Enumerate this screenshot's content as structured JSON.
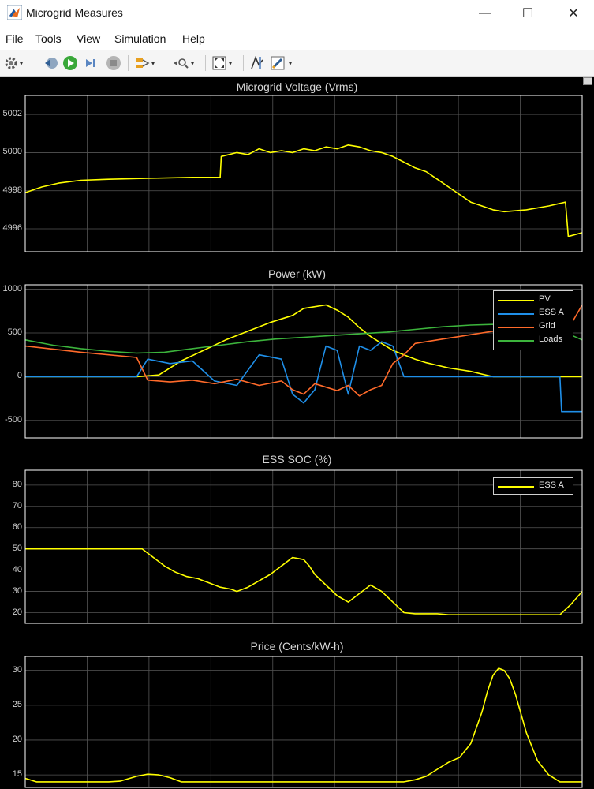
{
  "window": {
    "title": "Microgrid Measures",
    "minimize": "—",
    "maximize": "☐",
    "close": "✕"
  },
  "menu": [
    "File",
    "Tools",
    "View",
    "Simulation",
    "Help"
  ],
  "toolbar": {
    "icons": [
      "settings-icon",
      "step-back-icon",
      "run-icon",
      "step-forward-icon",
      "stop-icon",
      "highlight-icon",
      "zoom-icon",
      "autoscale-icon",
      "cursor-measure-icon",
      "style-icon"
    ]
  },
  "colors": {
    "pv": "#ffff00",
    "ess": "#1f8fe8",
    "grid": "#ff6a2a",
    "loads": "#3cb43c",
    "axis": "#ffffff",
    "grid_lines": "#555555"
  },
  "plots": [
    {
      "title": "Microgrid Voltage (Vrms)",
      "yticks": [
        "5002",
        "5000",
        "4998",
        "4996"
      ]
    },
    {
      "title": "Power  (kW)",
      "yticks": [
        "1000",
        "500",
        "0",
        "-500"
      ],
      "legend": [
        "PV",
        "ESS A",
        "Grid",
        "Loads"
      ]
    },
    {
      "title": "ESS SOC (%)",
      "yticks": [
        "80",
        "70",
        "60",
        "50",
        "40",
        "30",
        "20"
      ],
      "legend": [
        "ESS A"
      ]
    },
    {
      "title": "Price (Cents/kW-h)",
      "yticks": [
        "30",
        "25",
        "20",
        "15"
      ]
    }
  ],
  "chart_data": [
    {
      "type": "line",
      "title": "Microgrid Voltage (Vrms)",
      "ylim": [
        4994.8,
        5003
      ],
      "xlim": [
        0,
        100
      ],
      "grid": true,
      "series": [
        {
          "x": [
            0,
            3,
            6,
            10,
            15,
            22,
            30,
            35,
            35.2,
            38,
            40,
            42,
            44,
            46,
            48,
            50,
            52,
            54,
            56,
            58,
            60,
            62,
            64,
            66,
            68,
            70,
            72,
            74,
            76,
            78,
            80,
            82,
            84,
            86,
            90,
            94,
            97,
            97.5,
            100
          ],
          "y": [
            4997.9,
            4998.2,
            4998.4,
            4998.55,
            4998.6,
            4998.65,
            4998.7,
            4998.7,
            4999.8,
            5000.0,
            4999.9,
            5000.2,
            5000.0,
            5000.1,
            5000.0,
            5000.2,
            5000.1,
            5000.3,
            5000.2,
            5000.4,
            5000.3,
            5000.1,
            5000.0,
            4999.8,
            4999.5,
            4999.2,
            4999.0,
            4998.6,
            4998.2,
            4997.8,
            4997.4,
            4997.2,
            4997.0,
            4996.9,
            4997.0,
            4997.2,
            4997.4,
            4995.6,
            4995.8
          ]
        }
      ]
    },
    {
      "type": "line",
      "title": "Power  (kW)",
      "ylim": [
        -700,
        1050
      ],
      "xlim": [
        0,
        100
      ],
      "grid": true,
      "legend_position": "top-right",
      "series": [
        {
          "name": "PV",
          "x": [
            0,
            20,
            24,
            28,
            32,
            36,
            40,
            44,
            48,
            50,
            52,
            54,
            56,
            58,
            60,
            62,
            64,
            66,
            68,
            70,
            72,
            74,
            76,
            78,
            80,
            82,
            84,
            88,
            100
          ],
          "y": [
            0,
            0,
            20,
            180,
            300,
            420,
            520,
            620,
            700,
            780,
            800,
            820,
            760,
            680,
            560,
            460,
            380,
            300,
            250,
            200,
            160,
            130,
            100,
            80,
            60,
            30,
            0,
            0,
            0
          ]
        },
        {
          "name": "ESS A",
          "x": [
            0,
            20,
            22,
            26,
            30,
            34,
            38,
            42,
            46,
            48,
            50,
            52,
            54,
            56,
            58,
            60,
            62,
            64,
            66,
            68,
            70,
            74,
            78,
            82,
            90,
            96,
            96.3,
            100
          ],
          "y": [
            0,
            0,
            200,
            150,
            180,
            -50,
            -100,
            250,
            200,
            -200,
            -300,
            -150,
            350,
            300,
            -200,
            350,
            300,
            400,
            350,
            0,
            0,
            0,
            0,
            0,
            0,
            0,
            -400,
            -400
          ]
        },
        {
          "name": "Grid",
          "x": [
            0,
            10,
            20,
            22,
            26,
            30,
            34,
            38,
            42,
            46,
            48,
            50,
            52,
            54,
            56,
            58,
            60,
            62,
            64,
            66,
            68,
            70,
            72,
            74,
            76,
            78,
            80,
            82,
            84,
            86,
            90,
            94,
            98,
            100
          ],
          "y": [
            350,
            280,
            220,
            -40,
            -60,
            -40,
            -80,
            -30,
            -100,
            -50,
            -150,
            -200,
            -80,
            -120,
            -160,
            -100,
            -220,
            -150,
            -100,
            150,
            250,
            380,
            400,
            420,
            440,
            460,
            480,
            500,
            520,
            540,
            560,
            580,
            600,
            820
          ]
        },
        {
          "name": "Loads",
          "x": [
            0,
            5,
            10,
            15,
            20,
            25,
            30,
            35,
            40,
            45,
            50,
            55,
            60,
            65,
            70,
            75,
            80,
            85,
            90,
            95,
            100
          ],
          "y": [
            420,
            360,
            320,
            290,
            270,
            280,
            320,
            360,
            400,
            430,
            450,
            470,
            490,
            510,
            540,
            570,
            590,
            600,
            600,
            560,
            420
          ]
        }
      ]
    },
    {
      "type": "line",
      "title": "ESS SOC (%)",
      "ylim": [
        15,
        87
      ],
      "xlim": [
        0,
        100
      ],
      "grid": true,
      "legend_position": "top-right",
      "series": [
        {
          "name": "ESS A",
          "x": [
            0,
            10,
            20,
            21,
            23,
            25,
            27,
            29,
            31,
            33,
            35,
            37,
            38,
            40,
            42,
            44,
            46,
            48,
            50,
            51,
            52,
            54,
            56,
            58,
            60,
            62,
            64,
            66,
            68,
            70,
            72,
            74,
            76,
            80,
            90,
            96,
            98,
            100
          ],
          "y": [
            50,
            50,
            50,
            50,
            46,
            42,
            39,
            37,
            36,
            34,
            32,
            31,
            30,
            32,
            35,
            38,
            42,
            46,
            45,
            42,
            38,
            33,
            28,
            25,
            29,
            33,
            30,
            25,
            20,
            19.5,
            19.5,
            19.5,
            19,
            19,
            19,
            19,
            24,
            30
          ]
        }
      ]
    },
    {
      "type": "line",
      "title": "Price (Cents/kW-h)",
      "ylim": [
        13.2,
        32
      ],
      "xlim": [
        0,
        100
      ],
      "grid": true,
      "series": [
        {
          "x": [
            0,
            2,
            5,
            10,
            15,
            17,
            20,
            22,
            24,
            26,
            28,
            30,
            40,
            50,
            60,
            68,
            70,
            72,
            74,
            76,
            78,
            80,
            82,
            83,
            84,
            85,
            86,
            87,
            88,
            90,
            92,
            94,
            96,
            98,
            100
          ],
          "y": [
            14.5,
            14.0,
            14.0,
            14.0,
            14.0,
            14.1,
            14.8,
            15.1,
            15.0,
            14.6,
            14.0,
            14.0,
            14.0,
            14.0,
            14.0,
            14.0,
            14.3,
            14.8,
            15.8,
            16.8,
            17.5,
            19.5,
            24.0,
            27.0,
            29.3,
            30.3,
            30.0,
            28.8,
            26.6,
            21.0,
            17.0,
            15.0,
            14.0,
            14.0,
            14.0
          ]
        }
      ]
    }
  ]
}
